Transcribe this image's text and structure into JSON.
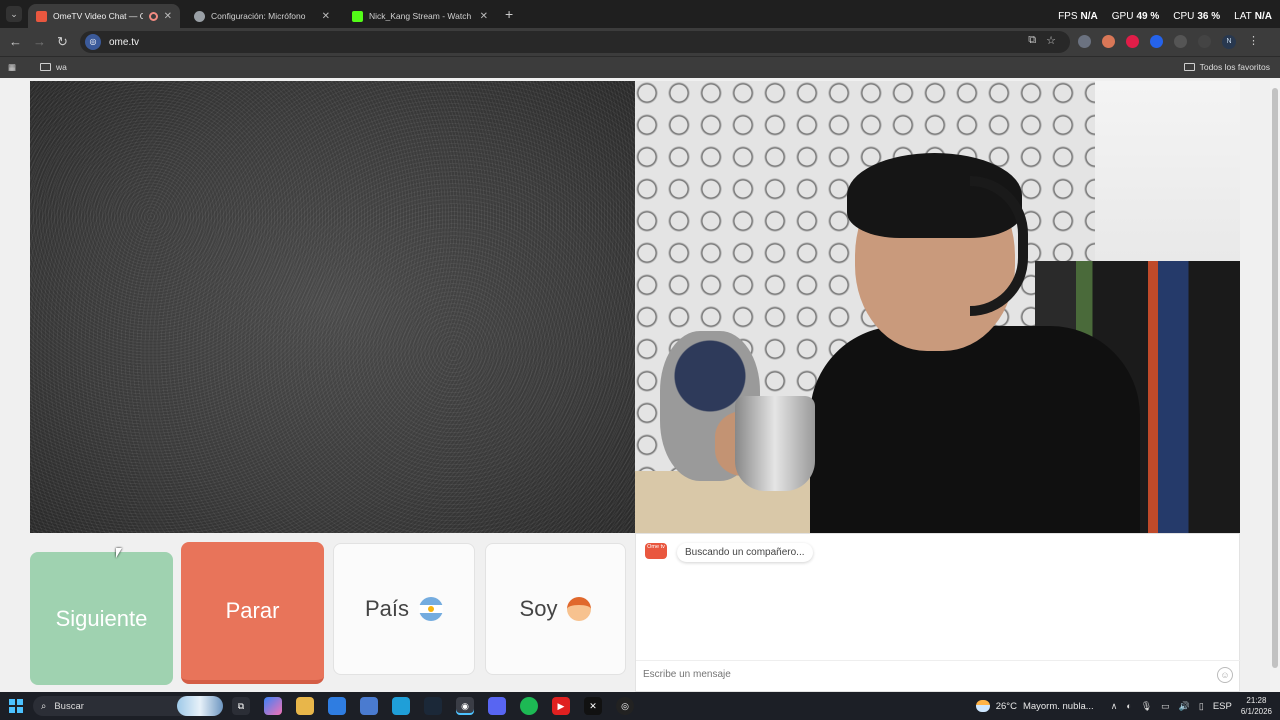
{
  "browser": {
    "tabs": [
      {
        "title": "OmeTV Video Chat — Ome",
        "color": "#e9573f",
        "active": true
      },
      {
        "title": "Configuración: Micrófono",
        "color": "#9aa0a6",
        "active": false
      },
      {
        "title": "Nick_Kang Stream - Watch Live",
        "color": "#53fc18",
        "active": false
      }
    ],
    "new_tab": "+",
    "url": "ome.tv",
    "bookmark_folder": "wa",
    "all_bookmarks": "Todos los favoritos",
    "profile_initial": "N"
  },
  "overlay": {
    "fps_label": "FPS",
    "fps_value": "N/A",
    "gpu_label": "GPU",
    "gpu_value": "49 %",
    "cpu_label": "CPU",
    "cpu_value": "36 %",
    "lat_label": "LAT",
    "lat_value": "N/A"
  },
  "controls": {
    "next_label": "Siguiente",
    "stop_label": "Parar",
    "country_label": "País",
    "gender_label": "Soy"
  },
  "chat": {
    "logo_text": "Ome tv",
    "status_message": "Buscando un compañero...",
    "input_placeholder": "Escribe un mensaje"
  },
  "taskbar": {
    "search_placeholder": "Buscar",
    "weather_temp": "26°C",
    "weather_desc": "Mayorm. nubla...",
    "language": "ESP",
    "time": "21:28",
    "date": "6/1/2026"
  },
  "colors": {
    "next_button": "#9fd2b0",
    "stop_button": "#e8745a",
    "brand": "#e9573f"
  }
}
